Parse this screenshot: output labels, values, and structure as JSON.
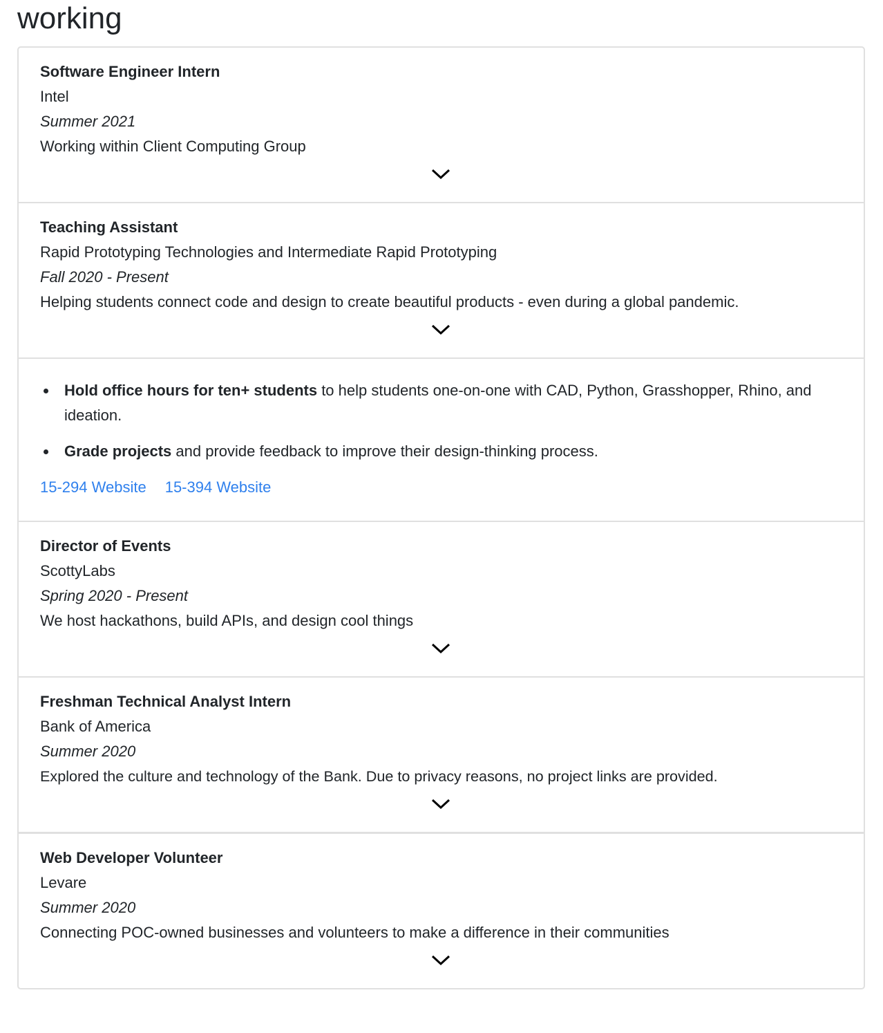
{
  "heading": "working",
  "cards": [
    {
      "title": "Software Engineer Intern",
      "org": "Intel",
      "date": "Summer 2021",
      "desc": "Working within Client Computing Group"
    },
    {
      "title": "Teaching Assistant",
      "org": "Rapid Prototyping Technologies and Intermediate Rapid Prototyping",
      "date": "Fall 2020 - Present",
      "desc": "Helping students connect code and design to create beautiful products - even during a global pandemic."
    },
    {
      "title": "Director of Events",
      "org": "ScottyLabs",
      "date": "Spring 2020 - Present",
      "desc": "We host hackathons, build APIs, and design cool things"
    },
    {
      "title": "Freshman Technical Analyst Intern",
      "org": "Bank of America",
      "date": "Summer 2020",
      "desc": "Explored the culture and technology of the Bank. Due to privacy reasons, no project links are provided."
    },
    {
      "title": "Web Developer Volunteer",
      "org": "Levare",
      "date": "Summer 2020",
      "desc": "Connecting POC-owned businesses and volunteers to make a difference in their communities"
    }
  ],
  "expanded": {
    "bullets": [
      {
        "bold": "Hold office hours for ten+ students",
        "rest": " to help students one-on-one with CAD, Python, Grasshopper, Rhino, and ideation."
      },
      {
        "bold": "Grade projects",
        "rest": " and provide feedback to improve their design-thinking process."
      }
    ],
    "links": [
      "15-294 Website",
      "15-394 Website"
    ]
  },
  "colors": {
    "link": "#2f80ed",
    "border": "#e0e0e0"
  }
}
